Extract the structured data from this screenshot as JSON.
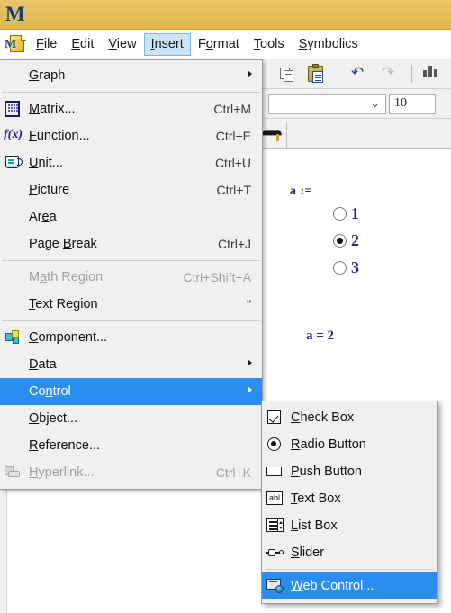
{
  "window": {
    "title": "",
    "app_logo_letter": "M",
    "titlebar_color": "#e6bd5c",
    "highlight_color": "#2a8ef0",
    "menu_active_color": "#cce4f7"
  },
  "menubar": {
    "app_icon": "mathcad-document-icon",
    "items": [
      {
        "label": "File",
        "mnemonic": "F",
        "active": false
      },
      {
        "label": "Edit",
        "mnemonic": "E",
        "active": false
      },
      {
        "label": "View",
        "mnemonic": "V",
        "active": false
      },
      {
        "label": "Insert",
        "mnemonic": "I",
        "active": true
      },
      {
        "label": "Format",
        "mnemonic": "o",
        "active": false
      },
      {
        "label": "Tools",
        "mnemonic": "T",
        "active": false
      },
      {
        "label": "Symbolics",
        "mnemonic": "S",
        "active": false
      }
    ]
  },
  "toolbar": {
    "buttons": [
      {
        "name": "copy-button",
        "label": "Copy",
        "enabled": true
      },
      {
        "name": "paste-button",
        "label": "Paste",
        "enabled": true
      },
      {
        "name": "undo-button",
        "label": "Undo",
        "enabled": true,
        "glyph": "↶"
      },
      {
        "name": "redo-button",
        "label": "Redo",
        "enabled": false,
        "glyph": "↷"
      },
      {
        "name": "align-button",
        "label": "Align",
        "enabled": true
      }
    ]
  },
  "format_bar": {
    "style_value": "",
    "style_placeholder": "",
    "font_size_value": "10",
    "chevron": "⌄"
  },
  "document": {
    "assignment_label": "a :=",
    "radio_group": {
      "name": "radio-button-control",
      "options": [
        {
          "label": "1",
          "selected": false
        },
        {
          "label": "2",
          "selected": true
        },
        {
          "label": "3",
          "selected": false
        }
      ]
    },
    "evaluation": "a = 2"
  },
  "insert_menu": {
    "name": "insert-dropdown-menu",
    "groups": [
      {
        "items": [
          {
            "label": "Graph",
            "mnemonic": "G",
            "accel": "",
            "icon": "",
            "submenu": true,
            "enabled": true,
            "highlighted": false
          }
        ]
      },
      {
        "items": [
          {
            "label": "Matrix...",
            "mnemonic": "M",
            "accel": "Ctrl+M",
            "icon": "matrix-icon",
            "submenu": false,
            "enabled": true,
            "highlighted": false
          },
          {
            "label": "Function...",
            "mnemonic": "F",
            "accel": "Ctrl+E",
            "icon": "function-icon",
            "submenu": false,
            "enabled": true,
            "highlighted": false
          },
          {
            "label": "Unit...",
            "mnemonic": "U",
            "accel": "Ctrl+U",
            "icon": "unit-icon",
            "submenu": false,
            "enabled": true,
            "highlighted": false
          },
          {
            "label": "Picture",
            "mnemonic": "P",
            "accel": "Ctrl+T",
            "icon": "",
            "submenu": false,
            "enabled": true,
            "highlighted": false
          },
          {
            "label": "Area",
            "mnemonic": "e",
            "accel": "",
            "icon": "",
            "submenu": false,
            "enabled": true,
            "highlighted": false
          },
          {
            "label": "Page Break",
            "mnemonic": "B",
            "accel": "Ctrl+J",
            "icon": "",
            "submenu": false,
            "enabled": true,
            "highlighted": false
          }
        ]
      },
      {
        "items": [
          {
            "label": "Math Region",
            "mnemonic": "a",
            "accel": "Ctrl+Shift+A",
            "icon": "",
            "submenu": false,
            "enabled": false,
            "highlighted": false
          },
          {
            "label": "Text Region",
            "mnemonic": "T",
            "accel": "\"",
            "icon": "",
            "submenu": false,
            "enabled": true,
            "highlighted": false
          }
        ]
      },
      {
        "items": [
          {
            "label": "Component...",
            "mnemonic": "C",
            "accel": "",
            "icon": "component-icon",
            "submenu": false,
            "enabled": true,
            "highlighted": false
          },
          {
            "label": "Data",
            "mnemonic": "D",
            "accel": "",
            "icon": "",
            "submenu": true,
            "enabled": true,
            "highlighted": false
          },
          {
            "label": "Control",
            "mnemonic": "n",
            "accel": "",
            "icon": "",
            "submenu": true,
            "enabled": true,
            "highlighted": true
          },
          {
            "label": "Object...",
            "mnemonic": "O",
            "accel": "",
            "icon": "",
            "submenu": false,
            "enabled": true,
            "highlighted": false
          },
          {
            "label": "Reference...",
            "mnemonic": "R",
            "accel": "",
            "icon": "",
            "submenu": false,
            "enabled": true,
            "highlighted": false
          },
          {
            "label": "Hyperlink...",
            "mnemonic": "H",
            "accel": "Ctrl+K",
            "icon": "hyperlink-icon",
            "submenu": false,
            "enabled": false,
            "highlighted": false
          }
        ]
      }
    ]
  },
  "control_submenu": {
    "name": "control-submenu",
    "groups": [
      {
        "items": [
          {
            "label": "Check Box",
            "mnemonic": "C",
            "icon": "checkbox-icon",
            "highlighted": false
          },
          {
            "label": "Radio Button",
            "mnemonic": "R",
            "icon": "radio-icon",
            "highlighted": false
          },
          {
            "label": "Push Button",
            "mnemonic": "P",
            "icon": "push-button-icon",
            "highlighted": false
          },
          {
            "label": "Text Box",
            "mnemonic": "T",
            "icon": "text-box-icon",
            "highlighted": false
          },
          {
            "label": "List Box",
            "mnemonic": "L",
            "icon": "list-box-icon",
            "highlighted": false
          },
          {
            "label": "Slider",
            "mnemonic": "S",
            "icon": "slider-icon",
            "highlighted": false
          }
        ]
      },
      {
        "items": [
          {
            "label": "Web Control...",
            "mnemonic": "W",
            "icon": "web-control-icon",
            "highlighted": true
          }
        ]
      }
    ]
  }
}
